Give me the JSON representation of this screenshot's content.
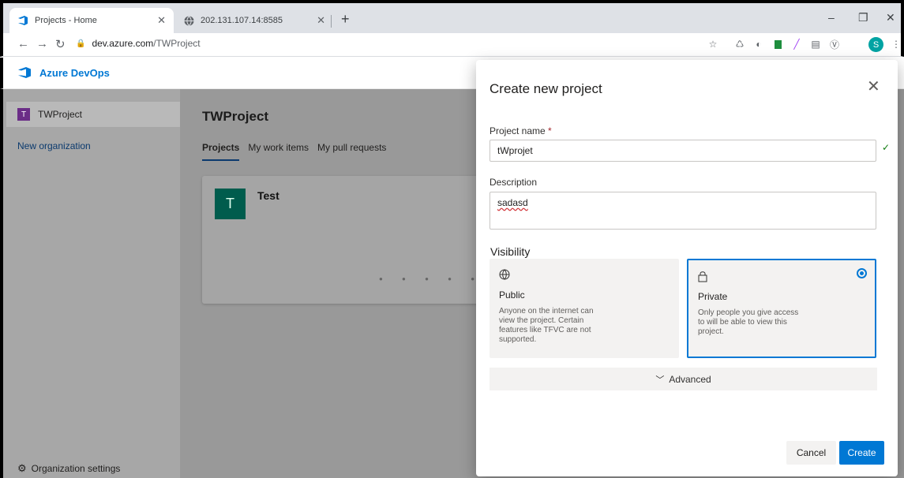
{
  "browser": {
    "tabs": [
      {
        "title": "Projects - Home",
        "active": true
      },
      {
        "title": "202.131.107.14:8585",
        "active": false
      }
    ],
    "url_domain": "dev.azure.com",
    "url_path": "/TWProject",
    "profile_initial": "S"
  },
  "app": {
    "brand": "Azure DevOps",
    "accent": "#0078d4"
  },
  "sidebar": {
    "org_initial": "T",
    "org_name": "TWProject",
    "new_org": "New organization",
    "settings": "Organization settings"
  },
  "main": {
    "title": "TWProject",
    "tabs": [
      "Projects",
      "My work items",
      "My pull requests"
    ],
    "card": {
      "initial": "T",
      "name": "Test"
    }
  },
  "dialog": {
    "title": "Create new project",
    "project_name_label": "Project name",
    "required_mark": "*",
    "project_name_value": "tWprojet",
    "description_label": "Description",
    "description_value": "sadasd",
    "visibility_title": "Visibility",
    "public_name": "Public",
    "public_desc": "Anyone on the internet can view the project. Certain features like TFVC are not supported.",
    "private_name": "Private",
    "private_desc": "Only people you give access to will be able to view this project.",
    "selected_visibility": "Private",
    "advanced_label": "Advanced",
    "cancel_label": "Cancel",
    "create_label": "Create"
  }
}
